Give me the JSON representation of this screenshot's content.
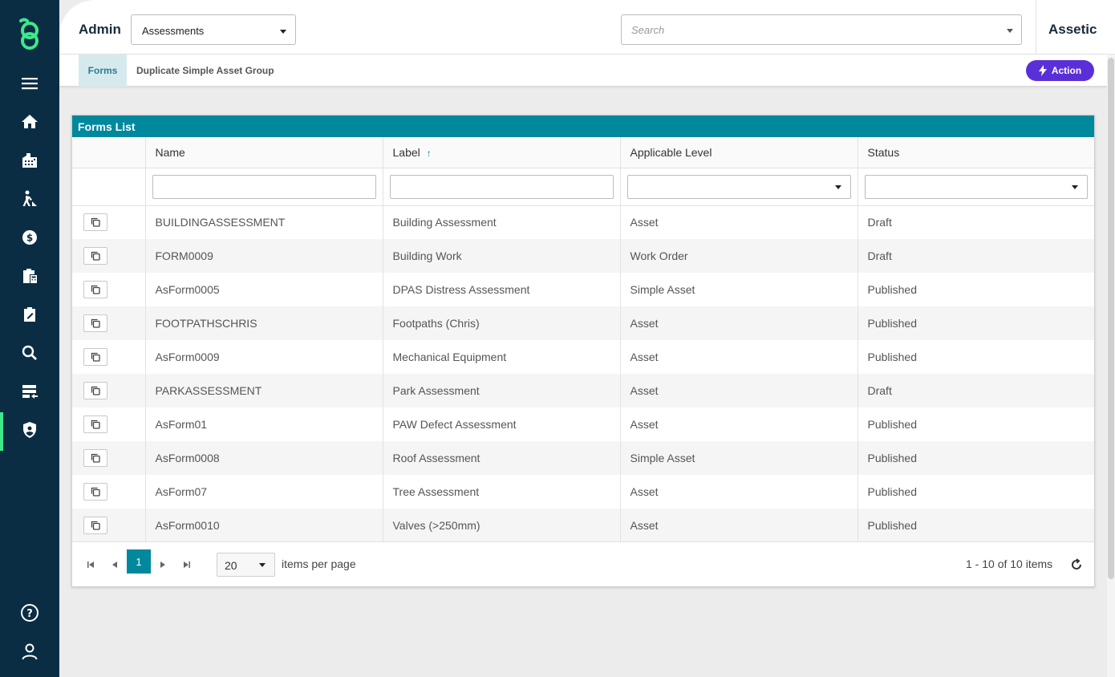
{
  "header": {
    "section_title": "Admin",
    "module_select": {
      "selected": "Assessments"
    },
    "search": {
      "placeholder": "Search"
    },
    "brand": "Assetic"
  },
  "subheader": {
    "active_tab": "Forms",
    "breadcrumb": "Duplicate Simple Asset Group",
    "action_label": "Action"
  },
  "nav": {
    "icons": [
      "menu-icon",
      "home-icon",
      "building-icon",
      "worker-icon",
      "finance-icon",
      "clipboard-calculator-icon",
      "assessment-icon",
      "search-icon",
      "data-transfer-icon",
      "admin-shield-icon",
      "help-icon",
      "user-icon"
    ],
    "accent_color": "#3ce98b"
  },
  "panel": {
    "title": "Forms List",
    "columns": [
      "Name",
      "Label",
      "Applicable Level",
      "Status"
    ],
    "sort_column": "Label",
    "sort_direction": "ascending",
    "rows": [
      {
        "name": "BUILDINGASSESSMENT",
        "label": "Building Assessment",
        "level": "Asset",
        "status": "Draft"
      },
      {
        "name": "FORM0009",
        "label": "Building Work",
        "level": "Work Order",
        "status": "Draft"
      },
      {
        "name": "AsForm0005",
        "label": "DPAS Distress Assessment",
        "level": "Simple Asset",
        "status": "Published"
      },
      {
        "name": "FOOTPATHSCHRIS",
        "label": "Footpaths (Chris)",
        "level": "Asset",
        "status": "Published"
      },
      {
        "name": "AsForm0009",
        "label": "Mechanical Equipment",
        "level": "Asset",
        "status": "Published"
      },
      {
        "name": "PARKASSESSMENT",
        "label": "Park Assessment",
        "level": "Asset",
        "status": "Draft"
      },
      {
        "name": "AsForm01",
        "label": "PAW Defect Assessment",
        "level": "Asset",
        "status": "Published"
      },
      {
        "name": "AsForm0008",
        "label": "Roof Assessment",
        "level": "Simple Asset",
        "status": "Published"
      },
      {
        "name": "AsForm07",
        "label": "Tree Assessment",
        "level": "Asset",
        "status": "Published"
      },
      {
        "name": "AsForm0010",
        "label": "Valves (>250mm)",
        "level": "Asset",
        "status": "Published"
      }
    ]
  },
  "pager": {
    "current_page": "1",
    "page_size": "20",
    "page_size_label": "items per page",
    "info": "1 - 10 of 10 items"
  },
  "colors": {
    "nav_bg": "#0b2d44",
    "teal": "#00889d",
    "action_purple": "#5b2fd8"
  }
}
